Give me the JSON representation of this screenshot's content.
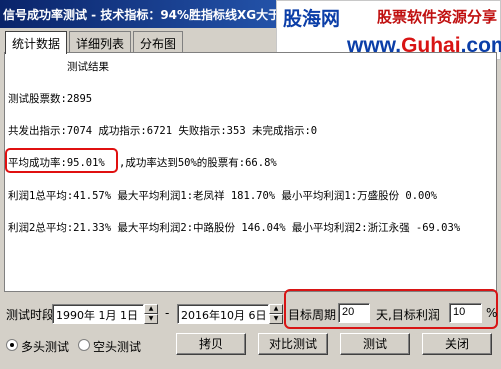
{
  "window": {
    "title": "信号成功率测试 - 技术指标：94%胜指标线XG大于0[…"
  },
  "watermark": {
    "logo": "股海网",
    "tagline": "股票软件资源分享",
    "url_prefix": "www.",
    "url_main": "Guhai",
    "url_suffix": ".com"
  },
  "tabs": [
    {
      "label": "统计数据",
      "active": true
    },
    {
      "label": "详细列表",
      "active": false
    },
    {
      "label": "分布图",
      "active": false
    }
  ],
  "result": {
    "heading": "测试结果",
    "total_stocks": "测试股票数:2895",
    "signals": "共发出指示:7074 成功指示:6721 失败指示:353 未完成指示:0",
    "avg_success_label": "平均成功率:95.01%",
    "avg_success_rest": ",成功率达到50%的股票有:66.8%",
    "profit1": "利润1总平均:41.57% 最大平均利润1:老凤祥   181.70% 最小平均利润1:万盛股份 0.00%",
    "profit2": "利润2总平均:21.33% 最大平均利润2:中路股份 146.04% 最小平均利润2:浙江永强 -69.03%"
  },
  "footer": {
    "period_label": "测试时段",
    "start_date": "1990年 1月 1日",
    "separator": "-",
    "end_date": "2016年10月 6日",
    "target_period_label": "目标周期",
    "target_period_value": "20",
    "days_label": "天,目标利润",
    "target_profit_value": "10",
    "percent": "%",
    "radio_long": "多头测试",
    "radio_short": "空头测试",
    "btn_copy": "拷贝",
    "btn_compare": "对比测试",
    "btn_test": "测试",
    "btn_close": "关闭"
  },
  "colors": {
    "title_bar": "#0a246a",
    "highlight": "#e01010"
  }
}
